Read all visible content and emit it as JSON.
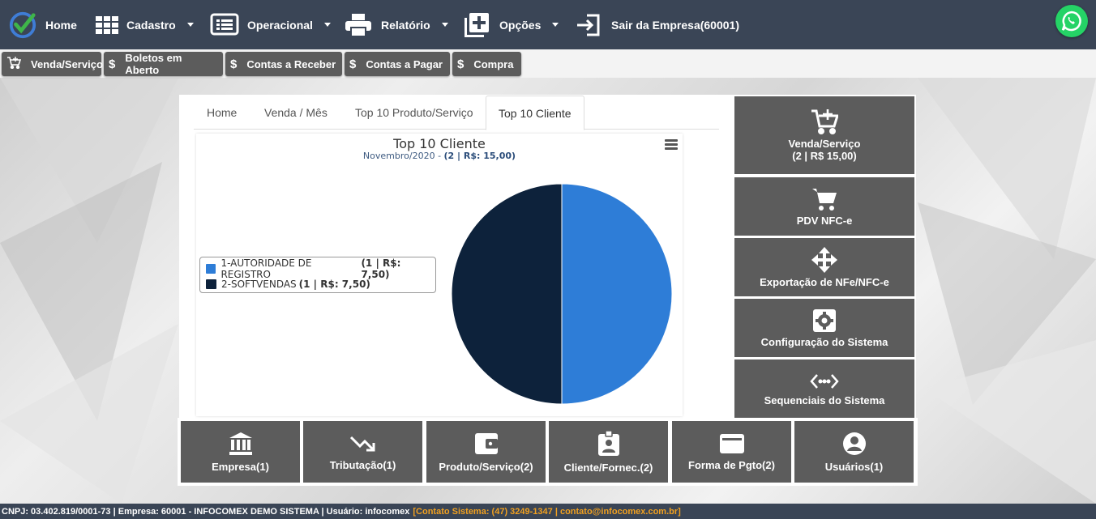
{
  "nav": {
    "home": "Home",
    "cadastro": "Cadastro",
    "operacional": "Operacional",
    "relatorio": "Relatório",
    "opcoes": "Opções",
    "sair": "Sair da Empresa(60001)"
  },
  "quickbar": {
    "venda": "Venda/Serviço",
    "boletos": "Boletos em Aberto",
    "receber": "Contas a Receber",
    "pagar": "Contas a Pagar",
    "compra": "Compra"
  },
  "tabs": [
    "Home",
    "Venda / Mês",
    "Top 10 Produto/Serviço",
    "Top 10 Cliente"
  ],
  "chart_data": {
    "type": "pie",
    "title": "Top 10 Cliente",
    "subtitle_prefix": "Novembro/2020 - ",
    "subtitle_bold": "(2 | R$: 15,00)",
    "series": [
      {
        "name": "1-AUTORIDADE DE REGISTRO",
        "label_bold": "(1 | R$: 7,50)",
        "value": 7.5,
        "color": "#2e7dd7"
      },
      {
        "name": "2-SOFTVENDAS",
        "label_bold": "(1 | R$: 7,50)",
        "value": 7.5,
        "color": "#0d223b"
      }
    ],
    "legend_placement": "left"
  },
  "side": {
    "venda_line1": "Venda/Serviço",
    "venda_line2": "(2 | R$ 15,00)",
    "pdv": "PDV NFC-e",
    "exportacao": "Exportação de NFe/NFC-e",
    "configuracao": "Configuração do Sistema",
    "sequenciais": "Sequenciais do Sistema"
  },
  "bottom": {
    "empresa": "Empresa(1)",
    "tributacao": "Tributação(1)",
    "produto": "Produto/Serviço(2)",
    "cliente": "Cliente/Fornec.(2)",
    "forma": "Forma de Pgto(2)",
    "usuarios": "Usuários(1)"
  },
  "footer": {
    "info": "CNPJ: 03.402.819/0001-73 | Empresa: 60001 - INFOCOMEX DEMO SISTEMA | Usuário: infocomex",
    "contact": "[Contato Sistema: (47) 3249-1347 | contato@infocomex.com.br]"
  },
  "colors": {
    "nav_bg": "#3a4556",
    "button_bg": "#5c5c5c",
    "whatsapp": "#25d366",
    "footer_contact": "#f0a020"
  }
}
